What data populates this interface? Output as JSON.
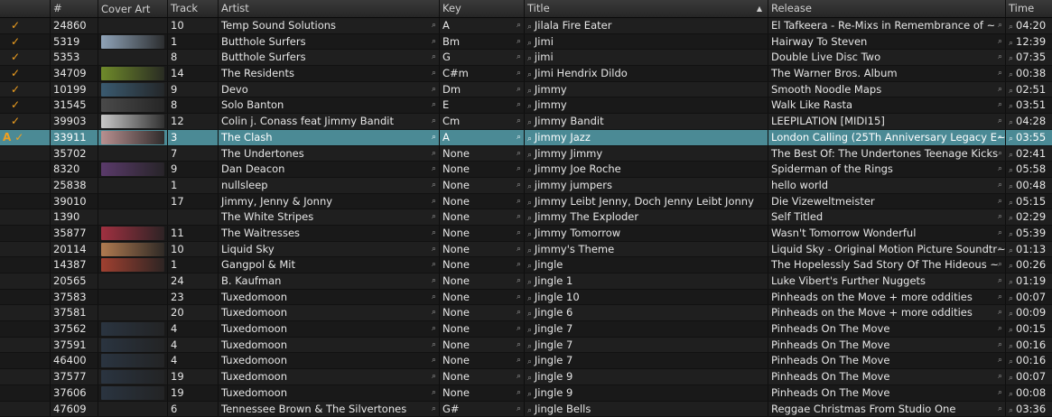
{
  "columns": {
    "num": "#",
    "cover": "Cover Art",
    "track": "Track",
    "artist": "Artist",
    "key": "Key",
    "title": "Title",
    "release": "Release",
    "time": "Time"
  },
  "sort_icon": "sort-ascending-icon",
  "flags": {
    "check": "✓",
    "auto": "A"
  },
  "rows": [
    {
      "checked": true,
      "num": "24860",
      "cover": "",
      "track": "10",
      "artist": "Temp Sound Solutions",
      "key": "A",
      "title": "Jilala Fire Eater",
      "release": "El Tafkeera - Re-Mixs in Remembrance of ~",
      "time": "04:20"
    },
    {
      "checked": true,
      "num": "5319",
      "cover": "#8fa3b8",
      "track": "1",
      "artist": "Butthole Surfers",
      "key": "Bm",
      "title": "Jimi",
      "release": "Hairway To Steven",
      "time": "12:39"
    },
    {
      "checked": true,
      "num": "5353",
      "cover": "",
      "track": "8",
      "artist": "Butthole Surfers",
      "key": "G",
      "title": "jimi",
      "release": "Double Live Disc Two",
      "time": "07:35"
    },
    {
      "checked": true,
      "num": "34709",
      "cover": "#6f8a2a",
      "track": "14",
      "artist": "The Residents",
      "key": "C#m",
      "title": "Jimi Hendrix Dildo",
      "release": "The Warner Bros. Album",
      "time": "00:38"
    },
    {
      "checked": true,
      "num": "10199",
      "cover": "#3a5a70",
      "track": "9",
      "artist": "Devo",
      "key": "Dm",
      "title": "Jimmy",
      "release": "Smooth Noodle Maps",
      "time": "02:51"
    },
    {
      "checked": true,
      "num": "31545",
      "cover": "#4a4a4a",
      "track": "8",
      "artist": "Solo Banton",
      "key": "E",
      "title": "Jimmy",
      "release": "Walk Like Rasta",
      "time": "03:51"
    },
    {
      "checked": true,
      "num": "39903",
      "cover": "#c8c8c8",
      "track": "12",
      "artist": "Colin j. Conass feat Jimmy Bandit",
      "key": "Cm",
      "title": "Jimmy Bandit",
      "release": "LEEPILATION [MIDI15]",
      "time": "04:28"
    },
    {
      "checked": true,
      "auto": true,
      "selected": true,
      "num": "33911",
      "cover": "#b89090",
      "track": "3",
      "artist": "The Clash",
      "key": "A",
      "title": "Jimmy Jazz",
      "release": "London Calling (25Th Anniversary Legacy E~",
      "time": "03:55"
    },
    {
      "checked": false,
      "num": "35702",
      "cover": "",
      "track": "7",
      "artist": "The Undertones",
      "key": "None",
      "title": "Jimmy Jimmy",
      "release": "The Best Of: The Undertones Teenage Kicks",
      "time": "02:41"
    },
    {
      "checked": false,
      "num": "8320",
      "cover": "#5a3a6a",
      "track": "9",
      "artist": "Dan Deacon",
      "key": "None",
      "title": "Jimmy Joe Roche",
      "release": "Spiderman of the Rings",
      "time": "05:58"
    },
    {
      "checked": false,
      "num": "25838",
      "cover": "",
      "track": "1",
      "artist": "nullsleep",
      "key": "None",
      "title": "jimmy jumpers",
      "release": "hello world",
      "time": "00:48"
    },
    {
      "checked": false,
      "num": "39010",
      "cover": "",
      "track": "17",
      "artist": "Jimmy, Jenny & Jonny",
      "key": "None",
      "title": "Jimmy Leibt Jenny, Doch Jenny Leibt Jonny",
      "release": "Die Vizeweltmeister",
      "time": "05:15"
    },
    {
      "checked": false,
      "num": "1390",
      "cover": "",
      "track": "",
      "artist": "The White Stripes",
      "key": "None",
      "title": "Jimmy The Exploder",
      "release": "Self Titled",
      "time": "02:29"
    },
    {
      "checked": false,
      "num": "35877",
      "cover": "#a03040",
      "track": "11",
      "artist": "The Waitresses",
      "key": "None",
      "title": "Jimmy Tomorrow",
      "release": "Wasn't Tomorrow Wonderful",
      "time": "05:39"
    },
    {
      "checked": false,
      "num": "20114",
      "cover": "#b07a50",
      "track": "10",
      "artist": "Liquid Sky",
      "key": "None",
      "title": "Jimmy's Theme",
      "release": "Liquid Sky - Original Motion Picture Soundtr~",
      "time": "01:13"
    },
    {
      "checked": false,
      "num": "14387",
      "cover": "#a04030",
      "track": "1",
      "artist": "Gangpol & Mit",
      "key": "None",
      "title": "Jingle",
      "release": "The Hopelessly Sad Story Of The Hideous ~",
      "time": "00:26"
    },
    {
      "checked": false,
      "num": "20565",
      "cover": "",
      "track": "24",
      "artist": "B. Kaufman",
      "key": "None",
      "title": "Jingle 1",
      "release": "Luke Vibert's Further Nuggets",
      "time": "01:19"
    },
    {
      "checked": false,
      "num": "37583",
      "cover": "",
      "track": "23",
      "artist": "Tuxedomoon",
      "key": "None",
      "title": "Jingle 10",
      "release": " Pinheads on the Move  + more oddities",
      "time": "00:07"
    },
    {
      "checked": false,
      "num": "37581",
      "cover": "",
      "track": "20",
      "artist": "Tuxedomoon",
      "key": "None",
      "title": "Jingle 6",
      "release": " Pinheads on the Move  + more oddities",
      "time": "00:09"
    },
    {
      "checked": false,
      "num": "37562",
      "cover": "#2a3440",
      "track": "4",
      "artist": "Tuxedomoon",
      "key": "None",
      "title": "Jingle 7",
      "release": "Pinheads On The Move",
      "time": "00:15"
    },
    {
      "checked": false,
      "num": "37591",
      "cover": "#2a3440",
      "track": "4",
      "artist": "Tuxedomoon",
      "key": "None",
      "title": "Jingle 7",
      "release": "Pinheads On The Move",
      "time": "00:16"
    },
    {
      "checked": false,
      "num": "46400",
      "cover": "#2a3440",
      "track": "4",
      "artist": "Tuxedomoon",
      "key": "None",
      "title": "Jingle 7",
      "release": "Pinheads On The Move",
      "time": "00:16"
    },
    {
      "checked": false,
      "num": "37577",
      "cover": "#2a3440",
      "track": "19",
      "artist": "Tuxedomoon",
      "key": "None",
      "title": "Jingle 9",
      "release": "Pinheads On The Move",
      "time": "00:07"
    },
    {
      "checked": false,
      "num": "37606",
      "cover": "#2a3440",
      "track": "19",
      "artist": "Tuxedomoon",
      "key": "None",
      "title": "Jingle 9",
      "release": "Pinheads On The Move",
      "time": "00:08"
    },
    {
      "checked": false,
      "num": "47609",
      "cover": "",
      "track": "6",
      "artist": "Tennessee Brown & The Silvertones",
      "key": "G#",
      "title": "Jingle Bells",
      "release": "Reggae Christmas From Studio One",
      "time": "03:36"
    }
  ]
}
